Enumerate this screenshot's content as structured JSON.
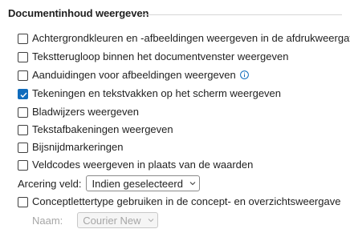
{
  "section": {
    "title": "Documentinhoud weergeven"
  },
  "options": [
    {
      "label": "Achtergrondkleuren en -afbeeldingen weergeven in de afdrukweergave",
      "checked": false
    },
    {
      "label": "Tekstterugloop binnen het documentvenster weergeven",
      "checked": false
    },
    {
      "label": "Aanduidingen voor afbeeldingen weergeven",
      "checked": false,
      "info_icon": "info-icon"
    },
    {
      "label": "Tekeningen en tekstvakken op het scherm weergeven",
      "checked": true
    },
    {
      "label": "Bladwijzers weergeven",
      "checked": false
    },
    {
      "label": "Tekstafbakeningen weergeven",
      "checked": false
    },
    {
      "label": "Bijsnijdmarkeringen",
      "checked": false
    },
    {
      "label": "Veldcodes weergeven in plaats van de waarden",
      "checked": false
    }
  ],
  "shading": {
    "label": "Arcering veld:",
    "value": "Indien geselecteerd"
  },
  "draft_font": {
    "label": "Conceptlettertype gebruiken in de concept- en overzichtsweergave",
    "checked": false
  },
  "font_name": {
    "label": "Naam:",
    "value": "Courier New",
    "enabled": false
  },
  "colors": {
    "accent": "#0f6cbd",
    "disabled": "#a6a6a6"
  }
}
